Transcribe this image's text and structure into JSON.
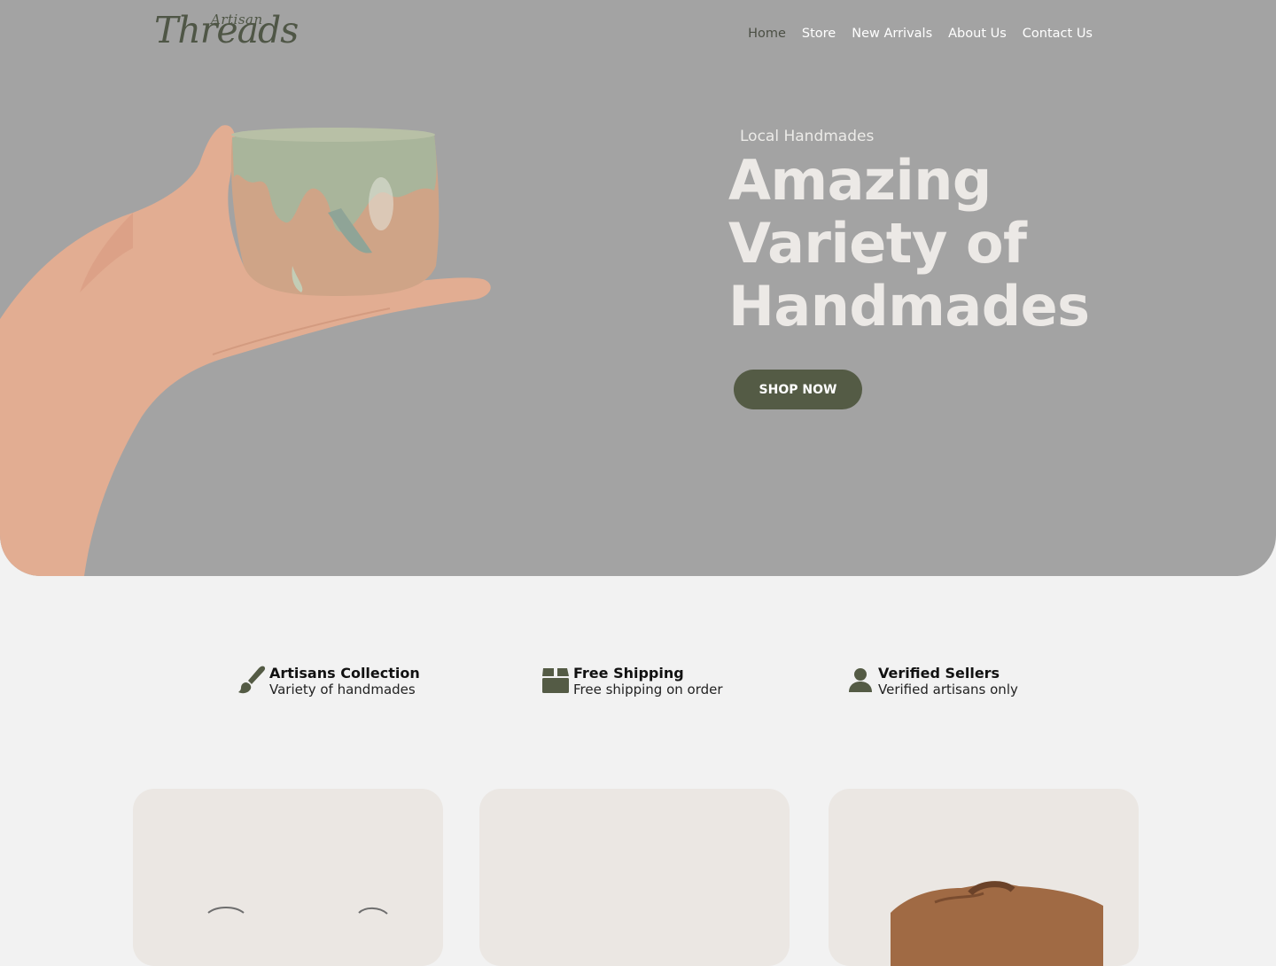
{
  "brand": {
    "logo_small": "Artisan",
    "logo_main": "Threads"
  },
  "nav": {
    "items": [
      "Home",
      "Store",
      "New Arrivals",
      "About Us",
      "Contact Us"
    ],
    "active": "Home"
  },
  "hero": {
    "eyebrow": "Local Handmades",
    "title_line1": "Amazing",
    "title_line2": "Variety of",
    "title_line3": "Handmades",
    "cta_label": "SHOP NOW",
    "image": "hand-holding-ceramic-cup"
  },
  "features": [
    {
      "icon": "paintbrush-icon",
      "title": "Artisans Collection",
      "subtitle": "Variety of handmades"
    },
    {
      "icon": "box-icon",
      "title": "Free Shipping",
      "subtitle": "Free shipping on order"
    },
    {
      "icon": "user-icon",
      "title": "Verified Sellers",
      "subtitle": "Verified artisans only"
    }
  ],
  "product_cards": [
    {
      "image": "product-earrings"
    },
    {
      "image": "product-empty"
    },
    {
      "image": "product-leather-bag"
    }
  ],
  "colors": {
    "accent": "#545b45",
    "hero_bg": "#a3a3a3",
    "page_bg": "#f2f2f2",
    "card_bg": "#ebe7e3"
  }
}
